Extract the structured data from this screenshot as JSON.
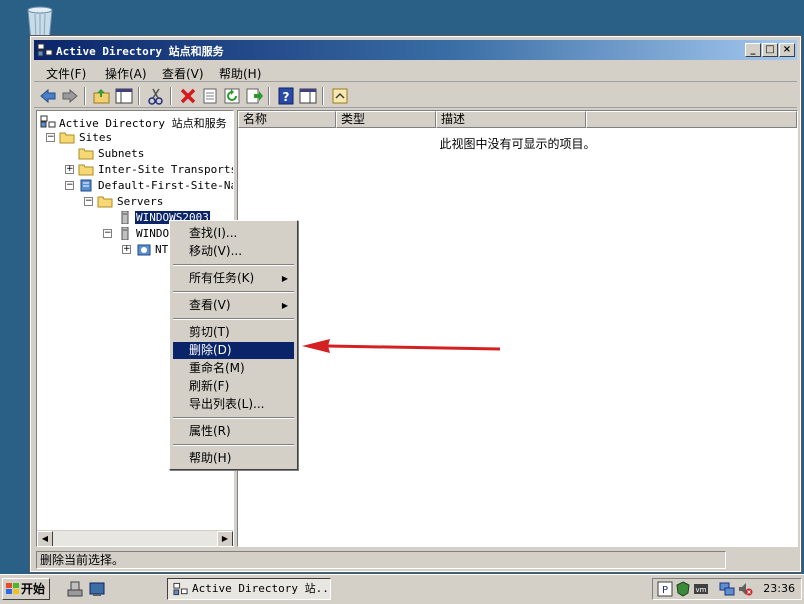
{
  "window": {
    "title": "Active Directory 站点和服务"
  },
  "menu": [
    "文件(F)",
    "操作(A)",
    "查看(V)",
    "帮助(H)"
  ],
  "toolbar_icons": [
    "back-icon",
    "forward-icon",
    "up-folder-icon",
    "show-hide-tree-icon",
    "cut-icon",
    "delete-icon",
    "properties-icon",
    "refresh-icon",
    "export-icon",
    "help-icon",
    "view-icon",
    "open-icon"
  ],
  "tree": {
    "root": "Active Directory 站点和服务",
    "sites": "Sites",
    "subnets": "Subnets",
    "inter_site": "Inter-Site Transports",
    "default_site": "Default-First-Site-Nam",
    "servers": "Servers",
    "server1": "WINDOWS2003",
    "server2": "WINDOW",
    "ntds": "NT"
  },
  "list": {
    "columns": [
      "名称",
      "类型",
      "描述"
    ],
    "empty_message": "此视图中没有可显示的项目。"
  },
  "context_menu": {
    "find": "查找(I)...",
    "move": "移动(V)...",
    "all_tasks": "所有任务(K)",
    "view": "查看(V)",
    "cut": "剪切(T)",
    "delete": "删除(D)",
    "rename": "重命名(M)",
    "refresh": "刷新(F)",
    "export": "导出列表(L)...",
    "properties": "属性(R)",
    "help": "帮助(H)"
  },
  "status": "删除当前选择。",
  "taskbar": {
    "start": "开始",
    "task": "Active Directory 站...",
    "clock": "23:36"
  },
  "colors": {
    "desktop": "#2a5f86",
    "selection": "#0a246a",
    "arrow": "#d42020"
  }
}
